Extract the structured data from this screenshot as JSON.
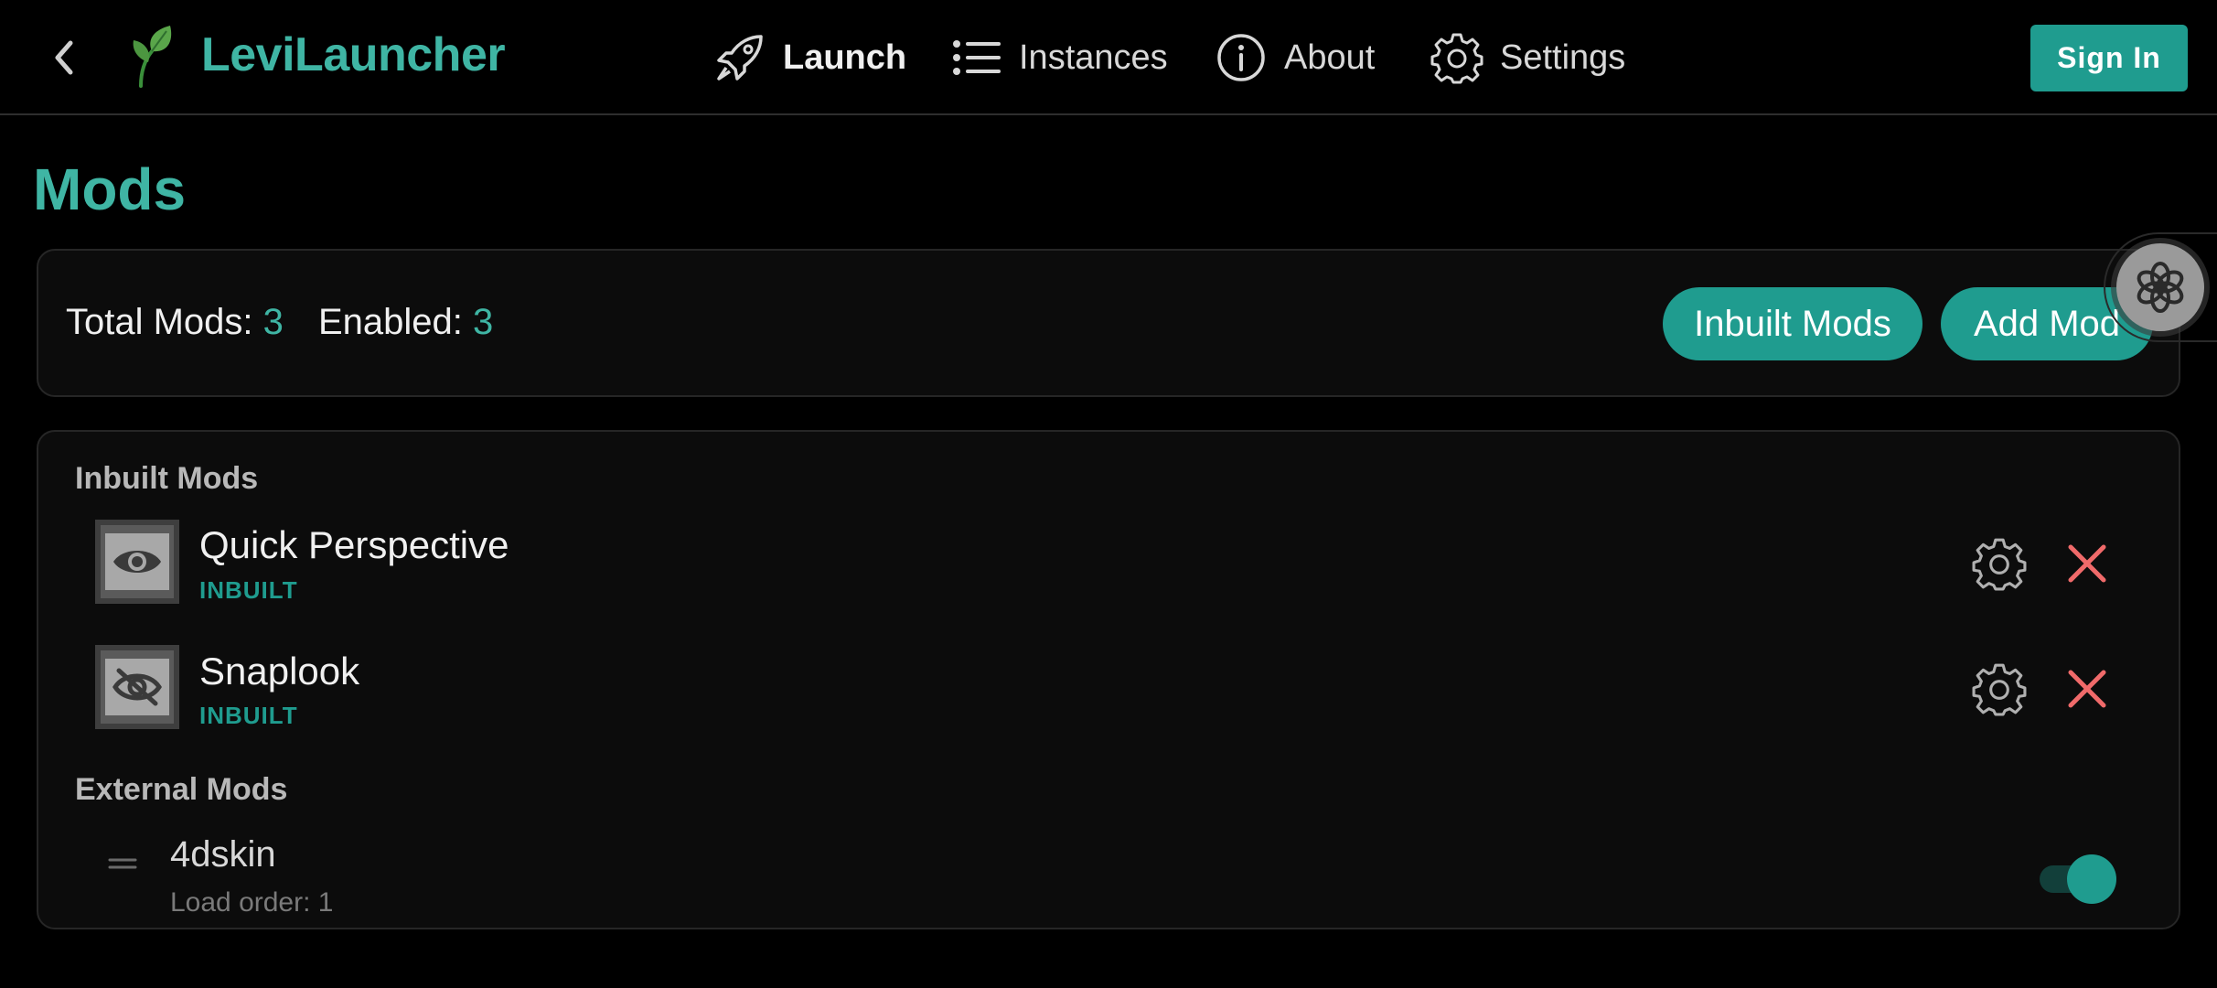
{
  "header": {
    "app_title": "LeviLauncher",
    "nav": [
      {
        "label": "Launch",
        "icon": "rocket-icon",
        "active": true
      },
      {
        "label": "Instances",
        "icon": "list-icon",
        "active": false
      },
      {
        "label": "About",
        "icon": "info-icon",
        "active": false
      },
      {
        "label": "Settings",
        "icon": "gear-icon",
        "active": false
      }
    ],
    "sign_in_label": "Sign In"
  },
  "page": {
    "title": "Mods"
  },
  "stats": {
    "total_label": "Total Mods:",
    "total_value": "3",
    "enabled_label": "Enabled:",
    "enabled_value": "3",
    "inbuilt_button": "Inbuilt Mods",
    "add_button": "Add Mod"
  },
  "mods": {
    "inbuilt_section": "Inbuilt Mods",
    "inbuilt": [
      {
        "name": "Quick Perspective",
        "tag": "INBUILT",
        "icon": "eye-icon"
      },
      {
        "name": "Snaplook",
        "tag": "INBUILT",
        "icon": "eye-off-icon"
      }
    ],
    "external_section": "External Mods",
    "external": [
      {
        "name": "4dskin",
        "load_order": "Load order: 1",
        "enabled": true
      }
    ]
  },
  "colors": {
    "accent": "#3fb5a4",
    "button": "#1f9c8f",
    "danger": "#f06a6a",
    "background": "#000000",
    "card": "#0c0c0c"
  }
}
